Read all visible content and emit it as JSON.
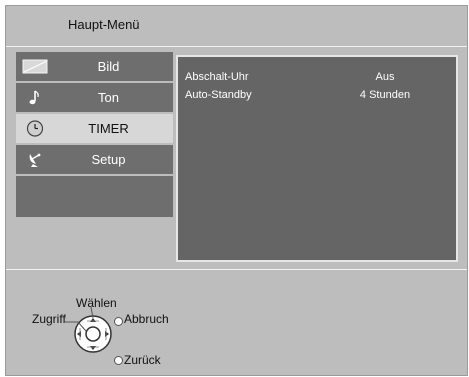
{
  "header": {
    "title": "Haupt-Menü"
  },
  "menu": {
    "items": [
      {
        "label": "Bild",
        "icon": "picture-icon",
        "selected": false
      },
      {
        "label": "Ton",
        "icon": "music-note-icon",
        "selected": false
      },
      {
        "label": "TIMER",
        "icon": "clock-icon",
        "selected": true
      },
      {
        "label": "Setup",
        "icon": "satellite-dish-icon",
        "selected": false
      }
    ]
  },
  "panel": {
    "rows": [
      {
        "key": "Abschalt-Uhr",
        "value": "Aus"
      },
      {
        "key": "Auto-Standby",
        "value": "4 Stunden"
      }
    ]
  },
  "help": {
    "select": "Wählen",
    "access": "Zugriff",
    "cancel": "Abbruch",
    "back": "Zurück"
  },
  "colors": {
    "background": "#bdbdbd",
    "menu_item": "#6e6e6e",
    "menu_selected": "#d7d7d7",
    "panel": "#656565"
  }
}
